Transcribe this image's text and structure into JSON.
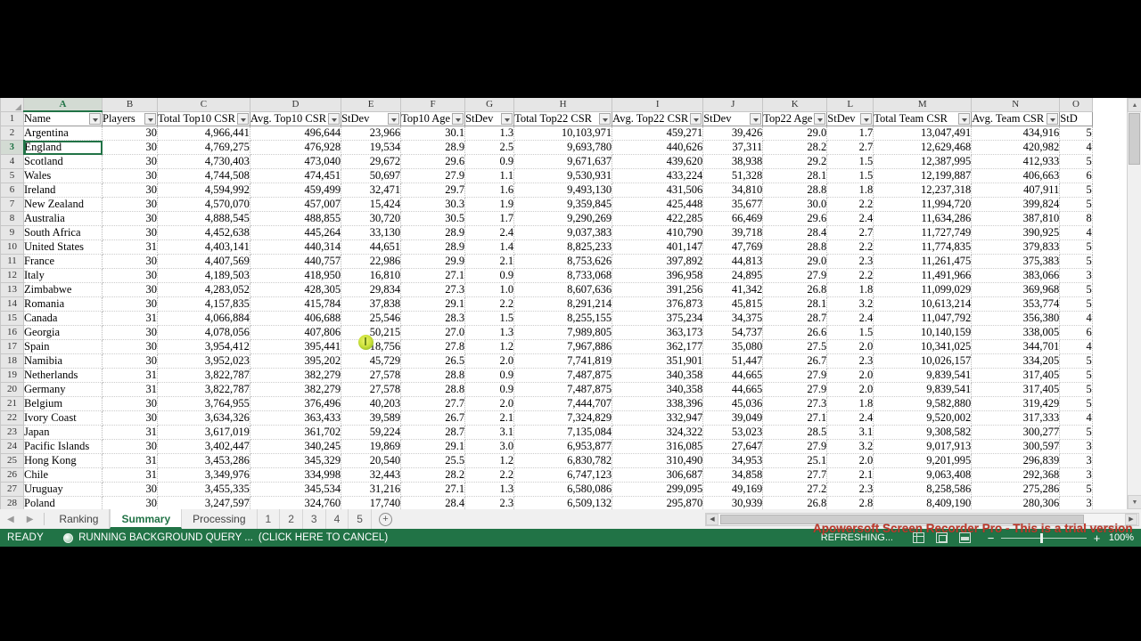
{
  "app": {
    "selected_cell": "A3",
    "zoom_label": "100%"
  },
  "columns": {
    "letters": [
      "A",
      "B",
      "C",
      "D",
      "E",
      "F",
      "G",
      "H",
      "I",
      "J",
      "K",
      "L",
      "M",
      "N",
      "O"
    ],
    "headers": [
      "Name",
      "Players",
      "Total Top10 CSR",
      "Avg. Top10 CSR",
      "StDev",
      "Top10 Age",
      "StDev",
      "Total Top22 CSR",
      "Avg. Top22 CSR",
      "StDev",
      "Top22 Age",
      "StDev",
      "Total Team CSR",
      "Avg. Team CSR",
      "StD"
    ]
  },
  "rows": [
    {
      "n": 2,
      "cells": [
        "Argentina",
        "30",
        "4,966,441",
        "496,644",
        "23,966",
        "30.1",
        "1.3",
        "10,103,971",
        "459,271",
        "39,426",
        "29.0",
        "1.7",
        "13,047,491",
        "434,916",
        "5"
      ]
    },
    {
      "n": 3,
      "cells": [
        "England",
        "30",
        "4,769,275",
        "476,928",
        "19,534",
        "28.9",
        "2.5",
        "9,693,780",
        "440,626",
        "37,311",
        "28.2",
        "2.7",
        "12,629,468",
        "420,982",
        "4"
      ]
    },
    {
      "n": 4,
      "cells": [
        "Scotland",
        "30",
        "4,730,403",
        "473,040",
        "29,672",
        "29.6",
        "0.9",
        "9,671,637",
        "439,620",
        "38,938",
        "29.2",
        "1.5",
        "12,387,995",
        "412,933",
        "5"
      ]
    },
    {
      "n": 5,
      "cells": [
        "Wales",
        "30",
        "4,744,508",
        "474,451",
        "50,697",
        "27.9",
        "1.1",
        "9,530,931",
        "433,224",
        "51,328",
        "28.1",
        "1.5",
        "12,199,887",
        "406,663",
        "6"
      ]
    },
    {
      "n": 6,
      "cells": [
        "Ireland",
        "30",
        "4,594,992",
        "459,499",
        "32,471",
        "29.7",
        "1.6",
        "9,493,130",
        "431,506",
        "34,810",
        "28.8",
        "1.8",
        "12,237,318",
        "407,911",
        "5"
      ]
    },
    {
      "n": 7,
      "cells": [
        "New Zealand",
        "30",
        "4,570,070",
        "457,007",
        "15,424",
        "30.3",
        "1.9",
        "9,359,845",
        "425,448",
        "35,677",
        "30.0",
        "2.2",
        "11,994,720",
        "399,824",
        "5"
      ]
    },
    {
      "n": 8,
      "cells": [
        "Australia",
        "30",
        "4,888,545",
        "488,855",
        "30,720",
        "30.5",
        "1.7",
        "9,290,269",
        "422,285",
        "66,469",
        "29.6",
        "2.4",
        "11,634,286",
        "387,810",
        "8"
      ]
    },
    {
      "n": 9,
      "cells": [
        "South Africa",
        "30",
        "4,452,638",
        "445,264",
        "33,130",
        "28.9",
        "2.4",
        "9,037,383",
        "410,790",
        "39,718",
        "28.4",
        "2.7",
        "11,727,749",
        "390,925",
        "4"
      ]
    },
    {
      "n": 10,
      "cells": [
        "United States",
        "31",
        "4,403,141",
        "440,314",
        "44,651",
        "28.9",
        "1.4",
        "8,825,233",
        "401,147",
        "47,769",
        "28.8",
        "2.2",
        "11,774,835",
        "379,833",
        "5"
      ]
    },
    {
      "n": 11,
      "cells": [
        "France",
        "30",
        "4,407,569",
        "440,757",
        "22,986",
        "29.9",
        "2.1",
        "8,753,626",
        "397,892",
        "44,813",
        "29.0",
        "2.3",
        "11,261,475",
        "375,383",
        "5"
      ]
    },
    {
      "n": 12,
      "cells": [
        "Italy",
        "30",
        "4,189,503",
        "418,950",
        "16,810",
        "27.1",
        "0.9",
        "8,733,068",
        "396,958",
        "24,895",
        "27.9",
        "2.2",
        "11,491,966",
        "383,066",
        "3"
      ]
    },
    {
      "n": 13,
      "cells": [
        "Zimbabwe",
        "30",
        "4,283,052",
        "428,305",
        "29,834",
        "27.3",
        "1.0",
        "8,607,636",
        "391,256",
        "41,342",
        "26.8",
        "1.8",
        "11,099,029",
        "369,968",
        "5"
      ]
    },
    {
      "n": 14,
      "cells": [
        "Romania",
        "30",
        "4,157,835",
        "415,784",
        "37,838",
        "29.1",
        "2.2",
        "8,291,214",
        "376,873",
        "45,815",
        "28.1",
        "3.2",
        "10,613,214",
        "353,774",
        "5"
      ]
    },
    {
      "n": 15,
      "cells": [
        "Canada",
        "31",
        "4,066,884",
        "406,688",
        "25,546",
        "28.3",
        "1.5",
        "8,255,155",
        "375,234",
        "34,375",
        "28.7",
        "2.4",
        "11,047,792",
        "356,380",
        "4"
      ]
    },
    {
      "n": 16,
      "cells": [
        "Georgia",
        "30",
        "4,078,056",
        "407,806",
        "50,215",
        "27.0",
        "1.3",
        "7,989,805",
        "363,173",
        "54,737",
        "26.6",
        "1.5",
        "10,140,159",
        "338,005",
        "6"
      ]
    },
    {
      "n": 17,
      "cells": [
        "Spain",
        "30",
        "3,954,412",
        "395,441",
        "18,756",
        "27.8",
        "1.2",
        "7,967,886",
        "362,177",
        "35,080",
        "27.5",
        "2.0",
        "10,341,025",
        "344,701",
        "4"
      ]
    },
    {
      "n": 18,
      "cells": [
        "Namibia",
        "30",
        "3,952,023",
        "395,202",
        "45,729",
        "26.5",
        "2.0",
        "7,741,819",
        "351,901",
        "51,447",
        "26.7",
        "2.3",
        "10,026,157",
        "334,205",
        "5"
      ]
    },
    {
      "n": 19,
      "cells": [
        "Netherlands",
        "31",
        "3,822,787",
        "382,279",
        "27,578",
        "28.8",
        "0.9",
        "7,487,875",
        "340,358",
        "44,665",
        "27.9",
        "2.0",
        "9,839,541",
        "317,405",
        "5"
      ]
    },
    {
      "n": 20,
      "cells": [
        "Germany",
        "31",
        "3,822,787",
        "382,279",
        "27,578",
        "28.8",
        "0.9",
        "7,487,875",
        "340,358",
        "44,665",
        "27.9",
        "2.0",
        "9,839,541",
        "317,405",
        "5"
      ]
    },
    {
      "n": 21,
      "cells": [
        "Belgium",
        "30",
        "3,764,955",
        "376,496",
        "40,203",
        "27.7",
        "2.0",
        "7,444,707",
        "338,396",
        "45,036",
        "27.3",
        "1.8",
        "9,582,880",
        "319,429",
        "5"
      ]
    },
    {
      "n": 22,
      "cells": [
        "Ivory Coast",
        "30",
        "3,634,326",
        "363,433",
        "39,589",
        "26.7",
        "2.1",
        "7,324,829",
        "332,947",
        "39,049",
        "27.1",
        "2.4",
        "9,520,002",
        "317,333",
        "4"
      ]
    },
    {
      "n": 23,
      "cells": [
        "Japan",
        "31",
        "3,617,019",
        "361,702",
        "59,224",
        "28.7",
        "3.1",
        "7,135,084",
        "324,322",
        "53,023",
        "28.5",
        "3.1",
        "9,308,582",
        "300,277",
        "5"
      ]
    },
    {
      "n": 24,
      "cells": [
        "Pacific Islands",
        "30",
        "3,402,447",
        "340,245",
        "19,869",
        "29.1",
        "3.0",
        "6,953,877",
        "316,085",
        "27,647",
        "27.9",
        "3.2",
        "9,017,913",
        "300,597",
        "3"
      ]
    },
    {
      "n": 25,
      "cells": [
        "Hong Kong",
        "31",
        "3,453,286",
        "345,329",
        "20,540",
        "25.5",
        "1.2",
        "6,830,782",
        "310,490",
        "34,953",
        "25.1",
        "2.0",
        "9,201,995",
        "296,839",
        "3"
      ]
    },
    {
      "n": 26,
      "cells": [
        "Chile",
        "31",
        "3,349,976",
        "334,998",
        "32,443",
        "28.2",
        "2.2",
        "6,747,123",
        "306,687",
        "34,858",
        "27.7",
        "2.1",
        "9,063,408",
        "292,368",
        "3"
      ]
    },
    {
      "n": 27,
      "cells": [
        "Uruguay",
        "30",
        "3,455,335",
        "345,534",
        "31,216",
        "27.1",
        "1.3",
        "6,580,086",
        "299,095",
        "49,169",
        "27.2",
        "2.3",
        "8,258,586",
        "275,286",
        "5"
      ]
    },
    {
      "n": 28,
      "cells": [
        "Poland",
        "30",
        "3,247,597",
        "324,760",
        "17,740",
        "28.4",
        "2.3",
        "6,509,132",
        "295,870",
        "30,939",
        "26.8",
        "2.8",
        "8,409,190",
        "280,306",
        "3"
      ]
    }
  ],
  "sheet_tabs": {
    "nav_first": "◀",
    "nav_prev": "▶",
    "items": [
      {
        "label": "Ranking",
        "active": false
      },
      {
        "label": "Summary",
        "active": true
      },
      {
        "label": "Processing",
        "active": false
      },
      {
        "label": "1",
        "active": false
      },
      {
        "label": "2",
        "active": false
      },
      {
        "label": "3",
        "active": false
      },
      {
        "label": "4",
        "active": false
      },
      {
        "label": "5",
        "active": false
      }
    ],
    "add_label": "+"
  },
  "status": {
    "ready": "READY",
    "query": "RUNNING BACKGROUND QUERY ...",
    "query_cancel": "(CLICK HERE TO CANCEL)",
    "refreshing": "REFRESHING...",
    "zoom_out": "−",
    "zoom_in": "+",
    "zoom": "100%"
  },
  "watermark": {
    "text": "Apowersoft Screen Recorder Pro - This is a trial version",
    "color": "#c0392b"
  }
}
